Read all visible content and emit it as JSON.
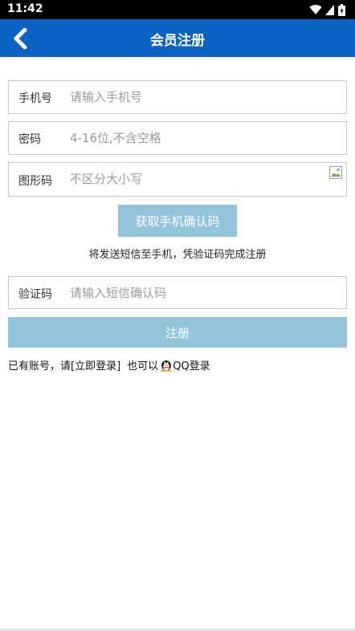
{
  "status_bar": {
    "time": "11:42"
  },
  "header": {
    "title": "会员注册",
    "back_icon": "chevron-left-icon"
  },
  "form": {
    "phone": {
      "label": "手机号",
      "placeholder": "请输入手机号",
      "value": ""
    },
    "password": {
      "label": "密码",
      "placeholder": "4-16位,不含空格",
      "value": ""
    },
    "captcha": {
      "label": "图形码",
      "placeholder": "不区分大小写",
      "value": ""
    },
    "sms_button": "获取手机确认码",
    "sms_hint": "将发送短信至手机，凭验证码完成注册",
    "sms_code": {
      "label": "验证码",
      "placeholder": "请输入短信确认码",
      "value": ""
    },
    "submit": "注册"
  },
  "footer": {
    "prefix": "已有账号，请",
    "login_link": "[立即登录]",
    "or_text": "也可以",
    "qq_login": "QQ登录"
  },
  "colors": {
    "header_bg": "#0b63c4",
    "button_bg": "#94c5dd"
  }
}
